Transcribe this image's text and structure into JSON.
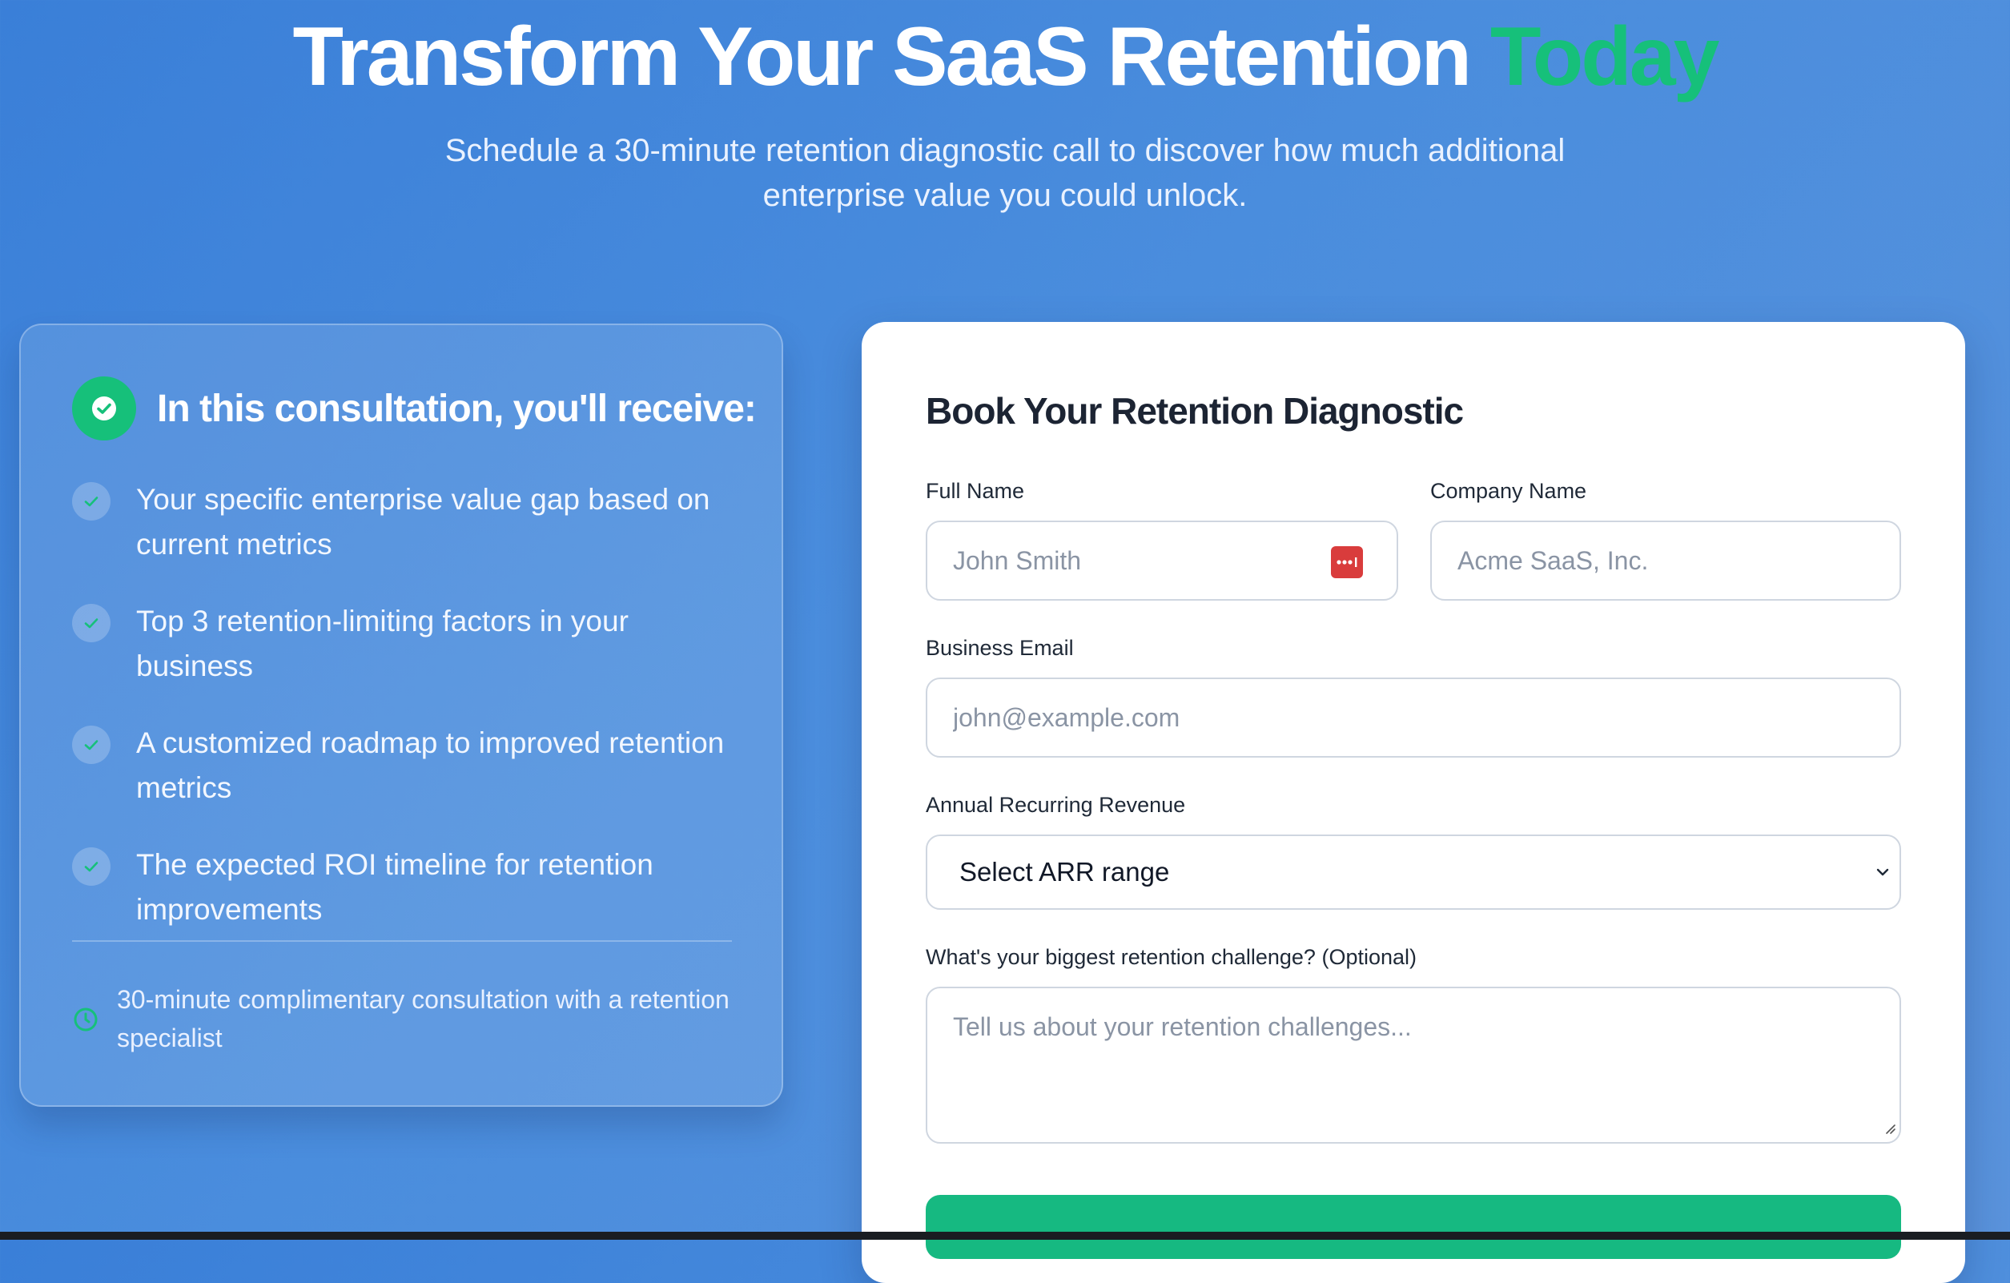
{
  "hero": {
    "title_main": "Transform Your SaaS Retention",
    "title_accent": "Today",
    "subtitle": "Schedule a 30-minute retention diagnostic call to discover how much additional enterprise value you could unlock."
  },
  "benefits": {
    "title": "In this consultation, you'll receive:",
    "items": [
      "Your specific enterprise value gap based on current metrics",
      "Top 3 retention-limiting factors in your business",
      "A customized roadmap to improved retention metrics",
      "The expected ROI timeline for retention improvements"
    ],
    "note": "30-minute complimentary consultation with a retention specialist"
  },
  "form": {
    "title": "Book Your Retention Diagnostic",
    "full_name": {
      "label": "Full Name",
      "placeholder": "John Smith"
    },
    "company_name": {
      "label": "Company Name",
      "placeholder": "Acme SaaS, Inc."
    },
    "email": {
      "label": "Business Email",
      "placeholder": "john@example.com"
    },
    "arr": {
      "label": "Annual Recurring Revenue",
      "value": "Select ARR range"
    },
    "challenge": {
      "label": "What's your biggest retention challenge? (Optional)",
      "placeholder": "Tell us about your retention challenges..."
    }
  },
  "colors": {
    "accent": "#16c07a",
    "button": "#16b981",
    "background_start": "#3a7fd8",
    "background_end": "#5a93dc"
  }
}
